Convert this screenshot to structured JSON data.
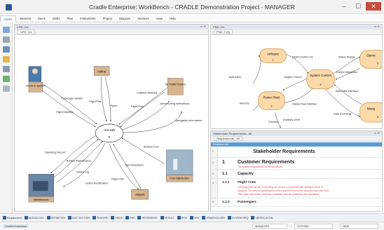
{
  "window": {
    "title": "Cradle Enterprise: WorkBench - CRADLE Demonstration Project - MANAGER",
    "minimize": "–",
    "maximize": "☐",
    "close": "✕"
  },
  "menu": [
    "Home",
    "Element",
    "Items",
    "Shifts",
    "Plan",
    "Instruments",
    "Project",
    "Diagram",
    "Services",
    "View",
    "Help"
  ],
  "left_pane": {
    "header": "CPD: Ctx",
    "tab": "CPD: Ctx",
    "nodes": {
      "aircraft": {
        "name": "Aircraft",
        "num": "0"
      },
      "airline": "Airline",
      "check_in": "Check In System",
      "atc": "Air Traffic Control",
      "fuel": "Fuel Distribution",
      "airport": "Airport",
      "maintenance": "Maintenance"
    },
    "flows": {
      "passenger_details": "Passenger Details",
      "flight_manifest": "Flight Manifest",
      "flight_plan_1": "Flight Plan",
      "flyers": "Flyers",
      "collision_warning": "Collision Warning",
      "flight_plan_2": "Flight Plan",
      "manoeuvring": "Manoeuvring Instructions",
      "navigation": "Navigation Information",
      "operating_record": "Operating Record",
      "routine_maintenance": "Routine Maintenance",
      "defect_log": "Defect Log",
      "defect_rectification": "Defect Rectification",
      "flight_plan_3": "Flight Plan",
      "taxi": "Taxi Instructions",
      "aviation_fuel": "Aviation Fuel"
    }
  },
  "right_top_pane": {
    "header": "PND: Ctx",
    "tab": "PND: 0 (6)",
    "nodes": {
      "airframe": {
        "name": "Airframe",
        "num": "1"
      },
      "system_control": {
        "name": "System Control",
        "num": "4"
      },
      "power_plant": {
        "name": "Power Plant",
        "num": "2"
      },
      "oper": {
        "name": "Opera",
        "num": "5"
      },
      "nav": {
        "name": "Navig",
        "num": "6"
      }
    },
    "flows": {
      "hydraulics": "Hydraulics",
      "flight_control_line": "Flight Control Line",
      "engine_control": "Engine Control",
      "electrics_1": "Electrics",
      "electrics_2": "Electrics",
      "status_data_interface": "Status Data Interface",
      "auxiliary_drive": "Auxiliary Drive",
      "status_display": "Status Display",
      "control_interaction": "Control Interaction",
      "raw_data_interface": "Raw Data Interface",
      "data_exchange": "Data Exchange"
    }
  },
  "requirements_pane": {
    "header": "Stakeholder Requirements - All",
    "tab": "Requirements - All",
    "banner": "Requirement",
    "rows": [
      {
        "idx": "1",
        "num": "",
        "title": "Stakeholder Requirements",
        "text": ""
      },
      {
        "idx": "2",
        "num": "1",
        "title": "Customer Requirements",
        "text": "The system requirements for the aircraft are."
      },
      {
        "idx": "3",
        "num": "1.1",
        "title": "Capacity",
        "text": ""
      },
      {
        "idx": "4",
        "num": "1.1.1",
        "title": "Flight Crew",
        "text": "The flying crew are key to ensuring the service is completed with allowable levels of"
      },
      {
        "idx": "",
        "num": "",
        "title": "",
        "text": "transport. The crew of operating the service shall be ensured by using pilot pool and crew"
      },
      {
        "idx": "",
        "num": "",
        "title": "",
        "text": "other flight crew duties, ensuring compliance with the guidelines and regulations."
      },
      {
        "idx": "5",
        "num": "1.1.2",
        "title": "Passengers",
        "text": ""
      }
    ]
  },
  "link_bar": [
    "Requirement",
    "DATA BLOCK",
    "DEFINITION",
    "DOC SECTION",
    "FEATURE",
    "ISSUE",
    "PBS",
    "REFERENCE",
    "RESULT",
    "RISK",
    "SRS",
    "STAKEHOLDER",
    "SYSTEM REQ",
    "VERIFICATION"
  ],
  "status_bar": {
    "left": "Cradle Enterprise",
    "box1": "MANAGER",
    "box2": "SYSTEM",
    "box3": "NEW"
  },
  "colors": {
    "context_node": "#d8b48f",
    "process_fill": "#fbd9a9",
    "process_stroke": "#c77a2c",
    "header_blue": "#dfe6ef",
    "banner": "#5b9bd5",
    "requirement_text": "#d9534f"
  }
}
